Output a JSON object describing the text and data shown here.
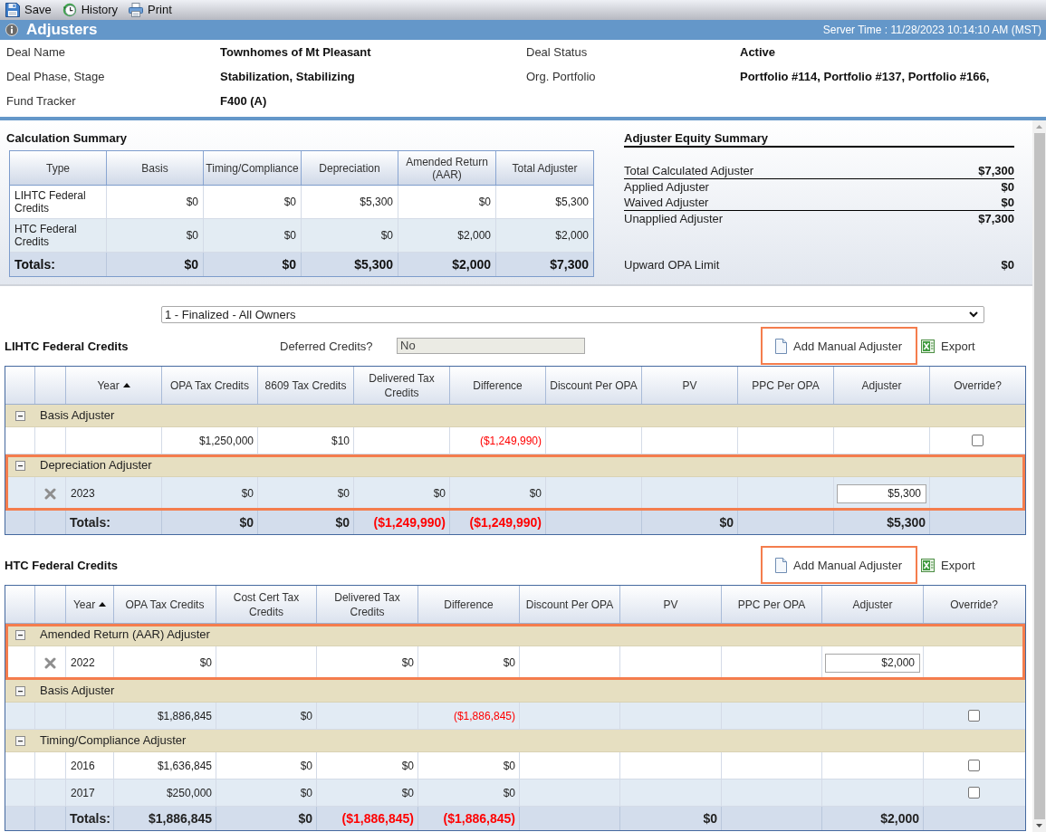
{
  "toolbar": [
    {
      "kind": "save",
      "label": "Save"
    },
    {
      "kind": "history",
      "label": "History"
    },
    {
      "kind": "print",
      "label": "Print"
    }
  ],
  "header": {
    "title": "Adjusters",
    "server_time": "Server Time : 11/28/2023 10:14:10 AM (MST)"
  },
  "deal_info": [
    {
      "label": "Deal Name",
      "value": "Townhomes of Mt Pleasant"
    },
    {
      "label": "Deal Status",
      "value": "Active"
    },
    {
      "label": "Deal Phase, Stage",
      "value": "Stabilization, Stabilizing"
    },
    {
      "label": "Org. Portfolio",
      "value": "Portfolio #114, Portfolio #137, Portfolio #166,"
    },
    {
      "label": "Fund Tracker",
      "value": "F400 (A)"
    }
  ],
  "calculation_summary": {
    "title": "Calculation Summary",
    "columns": [
      "Type",
      "Basis",
      "Timing/Compliance",
      "Depreciation",
      "Amended Return (AAR)",
      "Total Adjuster"
    ],
    "rows": [
      {
        "cells": [
          "LIHTC Federal Credits",
          "$0",
          "$0",
          "$5,300",
          "$0",
          "$5,300"
        ]
      },
      {
        "cells": [
          "HTC Federal Credits",
          "$0",
          "$0",
          "$0",
          "$2,000",
          "$2,000"
        ]
      }
    ],
    "totals": [
      "Totals:",
      "$0",
      "$0",
      "$5,300",
      "$2,000",
      "$7,300"
    ]
  },
  "equity_summary": {
    "title": "Adjuster Equity Summary",
    "rows": [
      {
        "label": "Total Calculated Adjuster",
        "value": "$7,300",
        "divider_below": true
      },
      {
        "label": "Applied Adjuster",
        "value": "$0",
        "divider_below": false
      },
      {
        "label": "Waived Adjuster",
        "value": "$0",
        "divider_below": true
      },
      {
        "label": "Unapplied Adjuster",
        "value": "$7,300",
        "divider_below": false
      }
    ],
    "upward_opa_limit": {
      "label": "Upward OPA Limit",
      "value": "$0"
    }
  },
  "owner_select": {
    "value": "1 - Finalized - All Owners"
  },
  "sections": [
    {
      "title": "LIHTC Federal Credits",
      "deferred_credits": {
        "label": "Deferred Credits?",
        "value": "No"
      },
      "actions": [
        {
          "kind": "add",
          "label": "Add Manual Adjuster",
          "highlighted": true
        },
        {
          "kind": "export",
          "label": "Export",
          "highlighted": false
        }
      ],
      "columns": [
        {
          "label": "Year",
          "sorted": true
        },
        {
          "label": "OPA Tax Credits",
          "sorted": false
        },
        {
          "label": "8609 Tax Credits",
          "sorted": false
        },
        {
          "label": "Delivered Tax Credits",
          "sorted": false
        },
        {
          "label": "Difference",
          "sorted": false
        },
        {
          "label": "Discount Per OPA",
          "sorted": false
        },
        {
          "label": "PV",
          "sorted": false
        },
        {
          "label": "PPC Per OPA",
          "sorted": false
        },
        {
          "label": "Adjuster",
          "sorted": false
        },
        {
          "label": "Override?",
          "sorted": false
        }
      ],
      "groups": [
        {
          "title": "Basis Adjuster",
          "expanded": true,
          "highlighted": false,
          "rows": [
            {
              "deletable": false,
              "opa_tax_credits": "$1,250,000",
              "certified_tax_credits": "$10",
              "difference": {
                "kind": "text",
                "text": "($1,249,990)",
                "negative": true
              },
              "override": {
                "kind": "checkbox",
                "checked": false
              }
            }
          ]
        },
        {
          "title": "Depreciation Adjuster",
          "expanded": true,
          "highlighted": true,
          "rows": [
            {
              "deletable": true,
              "year": "2023",
              "opa_tax_credits": "$0",
              "certified_tax_credits": "$0",
              "delivered_tax_credits": "$0",
              "difference": "$0",
              "adjuster": {
                "kind": "input",
                "value": "$5,300"
              }
            }
          ]
        }
      ],
      "totals": {
        "label": "Totals:",
        "opa_tax_credits": "$0",
        "certified_tax_credits": "$0",
        "delivered_tax_credits": {
          "kind": "text",
          "text": "($1,249,990)",
          "negative": true
        },
        "difference": {
          "kind": "text",
          "text": "($1,249,990)",
          "negative": true
        },
        "pv": "$0",
        "adjuster": "$5,300"
      }
    },
    {
      "title": "HTC Federal Credits",
      "actions": [
        {
          "kind": "add",
          "label": "Add Manual Adjuster",
          "highlighted": true
        },
        {
          "kind": "export",
          "label": "Export",
          "highlighted": false
        }
      ],
      "columns": [
        {
          "label": "Year",
          "sorted": true
        },
        {
          "label": "OPA Tax Credits",
          "sorted": false
        },
        {
          "label": "Cost Cert Tax Credits",
          "sorted": false
        },
        {
          "label": "Delivered Tax Credits",
          "sorted": false
        },
        {
          "label": "Difference",
          "sorted": false
        },
        {
          "label": "Discount Per OPA",
          "sorted": false
        },
        {
          "label": "PV",
          "sorted": false
        },
        {
          "label": "PPC Per OPA",
          "sorted": false
        },
        {
          "label": "Adjuster",
          "sorted": false
        },
        {
          "label": "Override?",
          "sorted": false
        }
      ],
      "groups": [
        {
          "title": "Amended Return (AAR) Adjuster",
          "expanded": true,
          "highlighted": true,
          "rows": [
            {
              "deletable": true,
              "year": "2022",
              "opa_tax_credits": "$0",
              "delivered_tax_credits": "$0",
              "difference": "$0",
              "adjuster": {
                "kind": "input",
                "value": "$2,000"
              }
            }
          ]
        },
        {
          "title": "Basis Adjuster",
          "expanded": true,
          "highlighted": false,
          "rows": [
            {
              "deletable": false,
              "opa_tax_credits": "$1,886,845",
              "certified_tax_credits": "$0",
              "difference": {
                "kind": "text",
                "text": "($1,886,845)",
                "negative": true
              },
              "override": {
                "kind": "checkbox",
                "checked": false
              }
            }
          ]
        },
        {
          "title": "Timing/Compliance Adjuster",
          "expanded": true,
          "highlighted": false,
          "rows": [
            {
              "deletable": false,
              "year": "2016",
              "opa_tax_credits": "$1,636,845",
              "certified_tax_credits": "$0",
              "delivered_tax_credits": "$0",
              "difference": "$0",
              "override": {
                "kind": "checkbox",
                "checked": false
              }
            },
            {
              "deletable": false,
              "year": "2017",
              "opa_tax_credits": "$250,000",
              "certified_tax_credits": "$0",
              "delivered_tax_credits": "$0",
              "difference": "$0",
              "override": {
                "kind": "checkbox",
                "checked": false
              }
            }
          ]
        }
      ],
      "totals": {
        "label": "Totals:",
        "opa_tax_credits": "$1,886,845",
        "certified_tax_credits": "$0",
        "delivered_tax_credits": {
          "kind": "text",
          "text": "($1,886,845)",
          "negative": true
        },
        "difference": {
          "kind": "text",
          "text": "($1,886,845)",
          "negative": true
        },
        "pv": "$0",
        "adjuster": "$2,000"
      }
    }
  ]
}
